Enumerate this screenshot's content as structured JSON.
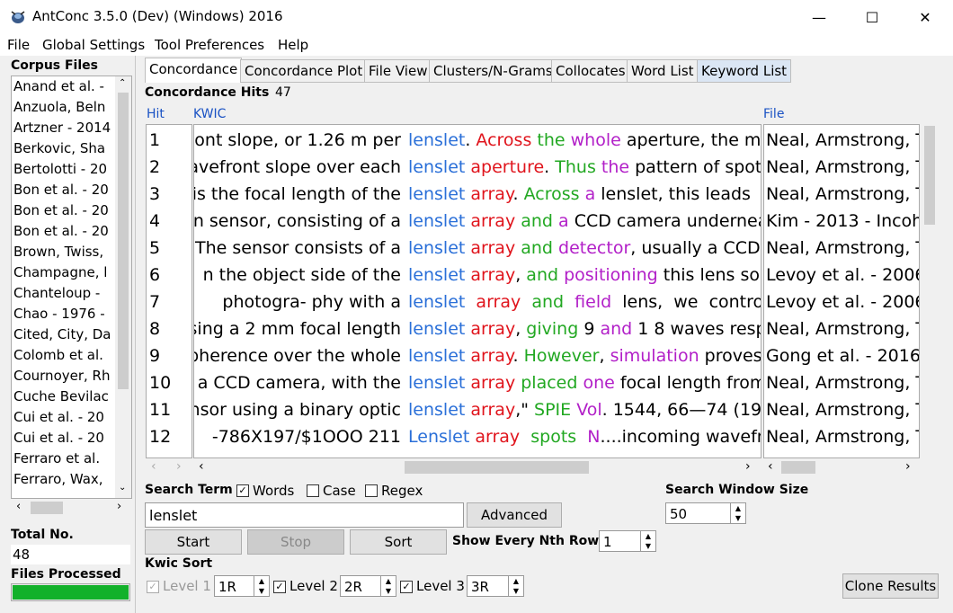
{
  "window": {
    "title": "AntConc 3.5.0 (Dev) (Windows) 2016",
    "minimize": "—",
    "maximize": "☐",
    "close": "✕"
  },
  "menu": [
    "File",
    "Global Settings",
    "Tool Preferences",
    "Help"
  ],
  "left": {
    "corpus_files_label": "Corpus Files",
    "files": [
      "Anand et al. -",
      "Anzuola, Beln",
      "Artzner - 2014",
      "Berkovic, Sha",
      "Bertolotti - 20",
      "Bon et al. - 20",
      "Bon et al. - 20",
      "Bon et al. - 20",
      "Brown, Twiss,",
      "Champagne, l",
      "Chanteloup -",
      "Chao - 1976 -",
      "Cited, City, Da",
      "Colomb et al.",
      "Cournoyer, Rh",
      "Cuche Bevilac",
      "Cui et al. - 20",
      "Cui et al. - 20",
      "Ferraro et al.",
      "Ferraro, Wax,"
    ],
    "total_no_label": "Total No.",
    "total_no_value": "48",
    "files_processed_label": "Files Processed",
    "files_processed_progress": 1.0
  },
  "tabs": [
    {
      "label": "Concordance",
      "active": true
    },
    {
      "label": "Concordance Plot"
    },
    {
      "label": "File View"
    },
    {
      "label": "Clusters/N-Grams"
    },
    {
      "label": "Collocates"
    },
    {
      "label": "Word List"
    },
    {
      "label": "Keyword List",
      "highlighted": true
    }
  ],
  "concordance": {
    "hits_label": "Concordance Hits",
    "hits_value": "47",
    "col_hit": "Hit",
    "col_kwic": "KWIC",
    "col_file": "File",
    "rows": [
      {
        "n": "1",
        "left": "ont slope, or 1.26 m per",
        "kw": "lenslet",
        "r": [
          [
            ". ",
            ""
          ],
          [
            "Across ",
            "red"
          ],
          [
            "the ",
            "green"
          ],
          [
            "whole ",
            "purple"
          ],
          [
            "aperture, the ma",
            ""
          ]
        ],
        "file": "Neal, Armstrong, T"
      },
      {
        "n": "2",
        "left": "avefront slope over each",
        "kw": "lenslet",
        "r": [
          [
            " ",
            ""
          ],
          [
            "aperture",
            "red"
          ],
          [
            ". ",
            ""
          ],
          [
            "Thus ",
            "green"
          ],
          [
            "the ",
            "purple"
          ],
          [
            "pattern of spots",
            ""
          ]
        ],
        "file": "Neal, Armstrong, T"
      },
      {
        "n": "3",
        "left": "is the focal length of the",
        "kw": "lenslet",
        "r": [
          [
            " ",
            ""
          ],
          [
            "array",
            "red"
          ],
          [
            ". ",
            ""
          ],
          [
            "Across ",
            "green"
          ],
          [
            "a ",
            "purple"
          ],
          [
            "lenslet, this leads",
            ""
          ]
        ],
        "file": "Neal, Armstrong, T"
      },
      {
        "n": "4",
        "left": "n sensor, consisting of a",
        "kw": "lenslet",
        "r": [
          [
            " ",
            ""
          ],
          [
            "array ",
            "red"
          ],
          [
            "and ",
            "green"
          ],
          [
            "a ",
            "purple"
          ],
          [
            "CCD camera underneat",
            ""
          ]
        ],
        "file": "Kim - 2013 - Incoh"
      },
      {
        "n": "5",
        "left": "The sensor consists of a",
        "kw": "lenslet",
        "r": [
          [
            " ",
            ""
          ],
          [
            "array ",
            "red"
          ],
          [
            "and ",
            "green"
          ],
          [
            "detector",
            "purple"
          ],
          [
            ", usually a CCD",
            ""
          ]
        ],
        "file": "Neal, Armstrong, T"
      },
      {
        "n": "6",
        "left": "n  the  object side of the",
        "kw": "lenslet",
        "r": [
          [
            " ",
            ""
          ],
          [
            "array",
            "red"
          ],
          [
            ", ",
            ""
          ],
          [
            "and ",
            "green"
          ],
          [
            "positioning ",
            "purple"
          ],
          [
            "this lens so",
            ""
          ]
        ],
        "file": "Levoy et al. - 2006"
      },
      {
        "n": "7",
        "left": "photogra- phy with  a",
        "kw": "lenslet",
        "r": [
          [
            "  ",
            ""
          ],
          [
            "array  ",
            "red"
          ],
          [
            "and  ",
            "green"
          ],
          [
            "field  ",
            "purple"
          ],
          [
            "lens,  we  contro",
            ""
          ]
        ],
        "file": "Levoy et al. - 2006"
      },
      {
        "n": "8",
        "left": "sing a 2 mm focal length",
        "kw": "lenslet",
        "r": [
          [
            " ",
            ""
          ],
          [
            "array",
            "red"
          ],
          [
            ", ",
            ""
          ],
          [
            "giving ",
            "green"
          ],
          [
            "9 ",
            ""
          ],
          [
            "and ",
            "purple"
          ],
          [
            "1 8 waves resp",
            ""
          ]
        ],
        "file": "Neal, Armstrong, T"
      },
      {
        "n": "9",
        "left": "pherence over the whole",
        "kw": "lenslet",
        "r": [
          [
            " ",
            ""
          ],
          [
            "array",
            "red"
          ],
          [
            ". ",
            ""
          ],
          [
            "However",
            "green"
          ],
          [
            ", ",
            ""
          ],
          [
            "simulation ",
            "purple"
          ],
          [
            "proves",
            ""
          ]
        ],
        "file": "Gong et al. - 2016"
      },
      {
        "n": "10",
        "left": "y a CCD camera, with the",
        "kw": "lenslet",
        "r": [
          [
            " ",
            ""
          ],
          [
            "array ",
            "red"
          ],
          [
            "placed ",
            "green"
          ],
          [
            "one ",
            "purple"
          ],
          [
            "focal length from",
            ""
          ]
        ],
        "file": "Neal, Armstrong, T"
      },
      {
        "n": "11",
        "left": "nsor using a binary optic",
        "kw": "lenslet",
        "r": [
          [
            " ",
            ""
          ],
          [
            "array",
            "red"
          ],
          [
            ",\" ",
            ""
          ],
          [
            "SPIE ",
            "green"
          ],
          [
            "Vol",
            "purple"
          ],
          [
            ". 1544, 66—74 (19",
            ""
          ]
        ],
        "file": "Neal, Armstrong, T"
      },
      {
        "n": "12",
        "left": "-786X197/$1OOO 211",
        "kw": "Lenslet",
        "r": [
          [
            " ",
            ""
          ],
          [
            "array  ",
            "red"
          ],
          [
            "spots  ",
            "green"
          ],
          [
            "N",
            "purple"
          ],
          [
            "....incoming wavefro",
            ""
          ]
        ],
        "file": "Neal, Armstrong, T"
      }
    ]
  },
  "search": {
    "term_label": "Search Term",
    "words_label": "Words",
    "words_checked": true,
    "case_label": "Case",
    "case_checked": false,
    "regex_label": "Regex",
    "regex_checked": false,
    "term_value": "lenslet",
    "advanced_label": "Advanced",
    "window_size_label": "Search Window Size",
    "window_size_value": "50",
    "start_label": "Start",
    "stop_label": "Stop",
    "sort_label": "Sort",
    "nth_row_label": "Show Every Nth Row",
    "nth_row_value": "1"
  },
  "kwic_sort": {
    "label": "Kwic Sort",
    "level1_label": "Level 1",
    "level1_value": "1R",
    "level2_label": "Level 2",
    "level2_value": "2R",
    "level3_label": "Level 3",
    "level3_value": "3R",
    "clone_label": "Clone Results"
  },
  "colors": {
    "keyword": "#2a6fd8",
    "sort1": "#e0141c",
    "sort2": "#22a822",
    "sort3": "#b21fc8",
    "progress": "#12b12a"
  }
}
